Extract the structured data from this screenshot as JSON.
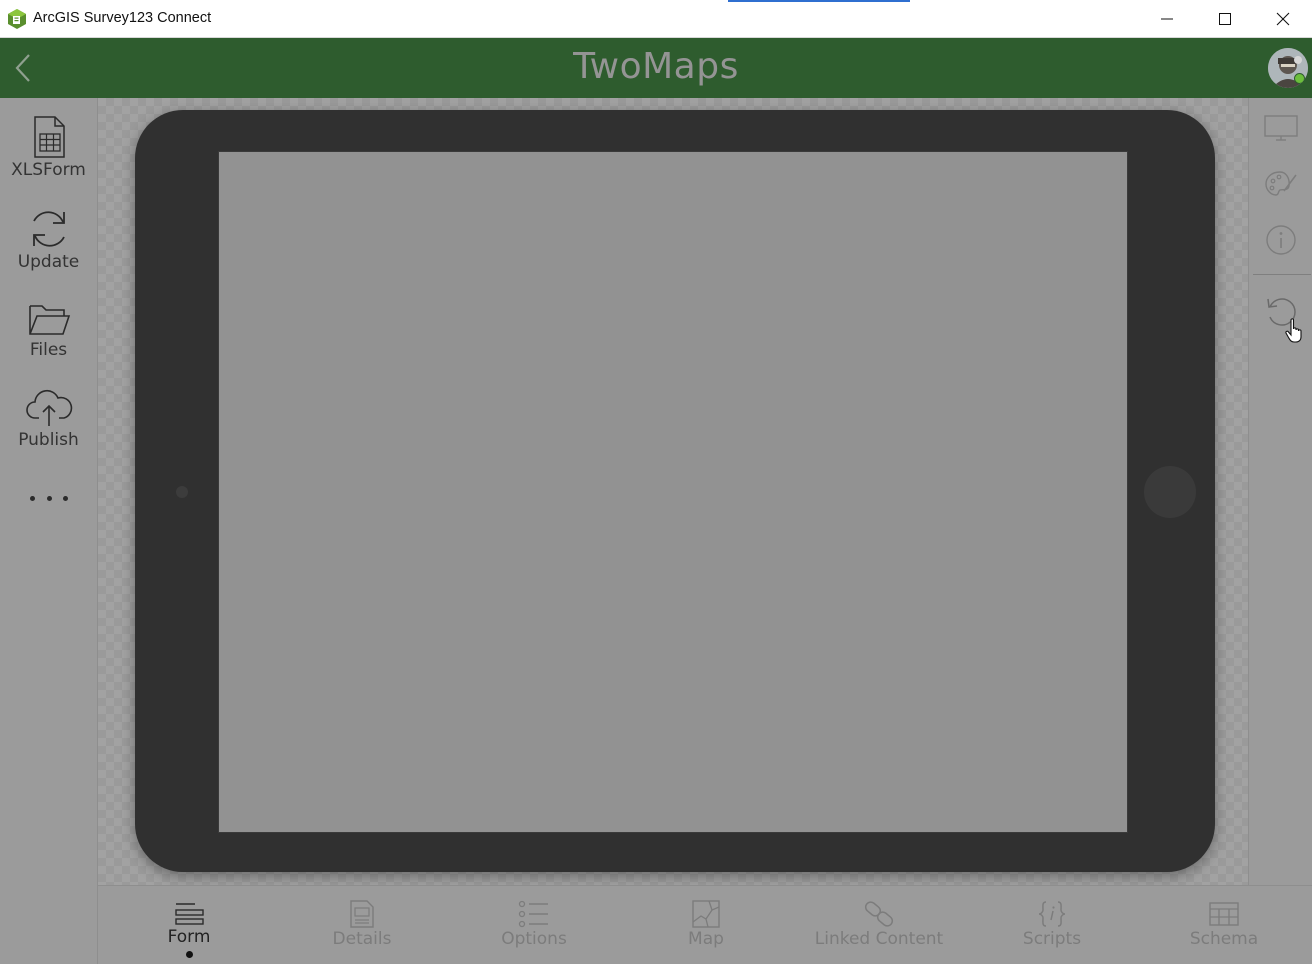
{
  "window": {
    "title": "ArcGIS Survey123 Connect",
    "controls": [
      "minimize",
      "maximize",
      "close"
    ]
  },
  "header": {
    "title": "TwoMaps",
    "background_color": "#2e5c2e"
  },
  "left_sidebar": {
    "items": [
      {
        "label": "XLSForm",
        "icon": "spreadsheet-icon"
      },
      {
        "label": "Update",
        "icon": "refresh-icon"
      },
      {
        "label": "Files",
        "icon": "folder-icon"
      },
      {
        "label": "Publish",
        "icon": "cloud-upload-icon"
      }
    ],
    "more_icon": "more-dots-icon"
  },
  "right_sidebar": {
    "items": [
      {
        "icon": "monitor-icon"
      },
      {
        "icon": "palette-icon"
      },
      {
        "icon": "info-icon"
      },
      {
        "icon": "reset-icon"
      }
    ]
  },
  "bottom_tabs": [
    {
      "label": "Form",
      "icon": "form-icon",
      "active": true
    },
    {
      "label": "Details",
      "icon": "details-icon",
      "active": false
    },
    {
      "label": "Options",
      "icon": "options-list-icon",
      "active": false
    },
    {
      "label": "Map",
      "icon": "map-icon",
      "active": false
    },
    {
      "label": "Linked Content",
      "icon": "link-icon",
      "active": false
    },
    {
      "label": "Scripts",
      "icon": "scripts-braces-icon",
      "active": false
    },
    {
      "label": "Schema",
      "icon": "schema-table-icon",
      "active": false
    }
  ]
}
